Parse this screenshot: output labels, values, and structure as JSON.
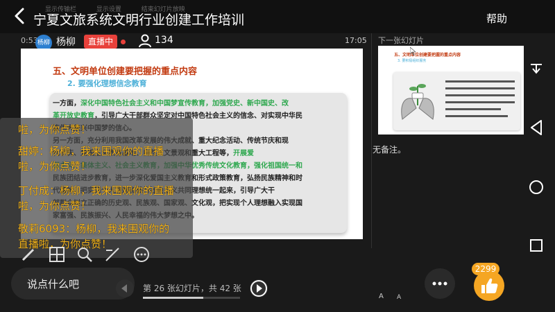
{
  "header": {
    "title": "宁夏文旅系统文明行业创建工作培训",
    "help_label": "帮助",
    "toolbar_labels": [
      "显示传输栏",
      "显示设置",
      "结束幻灯片放映"
    ]
  },
  "stream": {
    "time_left": "0:53",
    "time_right": "17:05",
    "avatar_label": "杨柳",
    "host_name": "杨柳",
    "live_badge": "直播中",
    "viewer_count": "134"
  },
  "slide": {
    "heading": "五、文明单位创建要把握的重点内容",
    "subheading": "2. 要强化理想信念教育",
    "lines": [
      {
        "a": "一方面，",
        "g": "深化中国特色社会主义和中国梦宣传教育，加强党史、新中国史、改",
        "b": ""
      },
      {
        "a": "",
        "g": "革开放史教育",
        "b": "，引导广大干部群众坚定对中国特色社会主义的信念、对实现中华民"
      },
      {
        "a": "族伟大复兴中国梦的信心。",
        "g": "",
        "b": ""
      },
      {
        "a": "另一方面，充分利用我国改革发展的伟大成就、重大纪念活动、传统节庆和现",
        "g": "",
        "b": ""
      },
      {
        "a": "代节庆、爱国主义教育基地、自然人文景观和重大工程等，",
        "g": "开展爱",
        "b": ""
      },
      {
        "a": "",
        "g": "国主义、集体主义、社会主义教育，加强中华优秀传统文化教育，强化祖国统一和",
        "b": ""
      },
      {
        "a": "民族团结进步教育，进一步深化爱国主义教育和形式政策教育",
        "g": "",
        "b": "，弘扬民族精神和时"
      },
      {
        "a": "代精神，把实现个人理想和践行社会主义共同理想统一起来，引导广大干",
        "g": "",
        "b": ""
      },
      {
        "a": "部群众树立正确的历史观、民族观、国家观、文化观，把实现个人理想融入实现国",
        "g": "",
        "b": ""
      },
      {
        "a": "家富强、民族振兴、人民幸福的伟大梦想之中。",
        "g": "",
        "b": ""
      }
    ]
  },
  "sidebar": {
    "next_label": "下一张幻灯片",
    "thumb_heading": "五、文明单位创建要把握的重点内容",
    "thumb_subheading": "3. 要积极组织服务",
    "notes": "无备注。"
  },
  "chat": [
    "啦，为你点赞！",
    "甜婷：杨柳，我来围观你的直播",
    "啦，为你点赞！",
    "丁付成：杨柳，我来围观你的直播",
    "啦，为你点赞！",
    "敬莉6093：杨柳，我来围观你的",
    "直播啦，为你点赞！"
  ],
  "controls": {
    "comment_placeholder": "说点什么吧",
    "page_info": "第 26 张幻灯片，共 42 张",
    "slide_progress": 0.62,
    "like_count": "2299",
    "font_increase": "A",
    "font_decrease": "A",
    "tool_icons": [
      "pen-icon",
      "layout-icon",
      "search-icon",
      "pointer-icon",
      "more-circle-icon"
    ]
  },
  "colors": {
    "live_red": "#e8413b",
    "chat_orange": "#f5b41a",
    "like_orange": "#f5a623",
    "heading_red": "#c23a10",
    "highlight_green": "#2fa84f",
    "subheading_blue": "#4cb0d8"
  }
}
